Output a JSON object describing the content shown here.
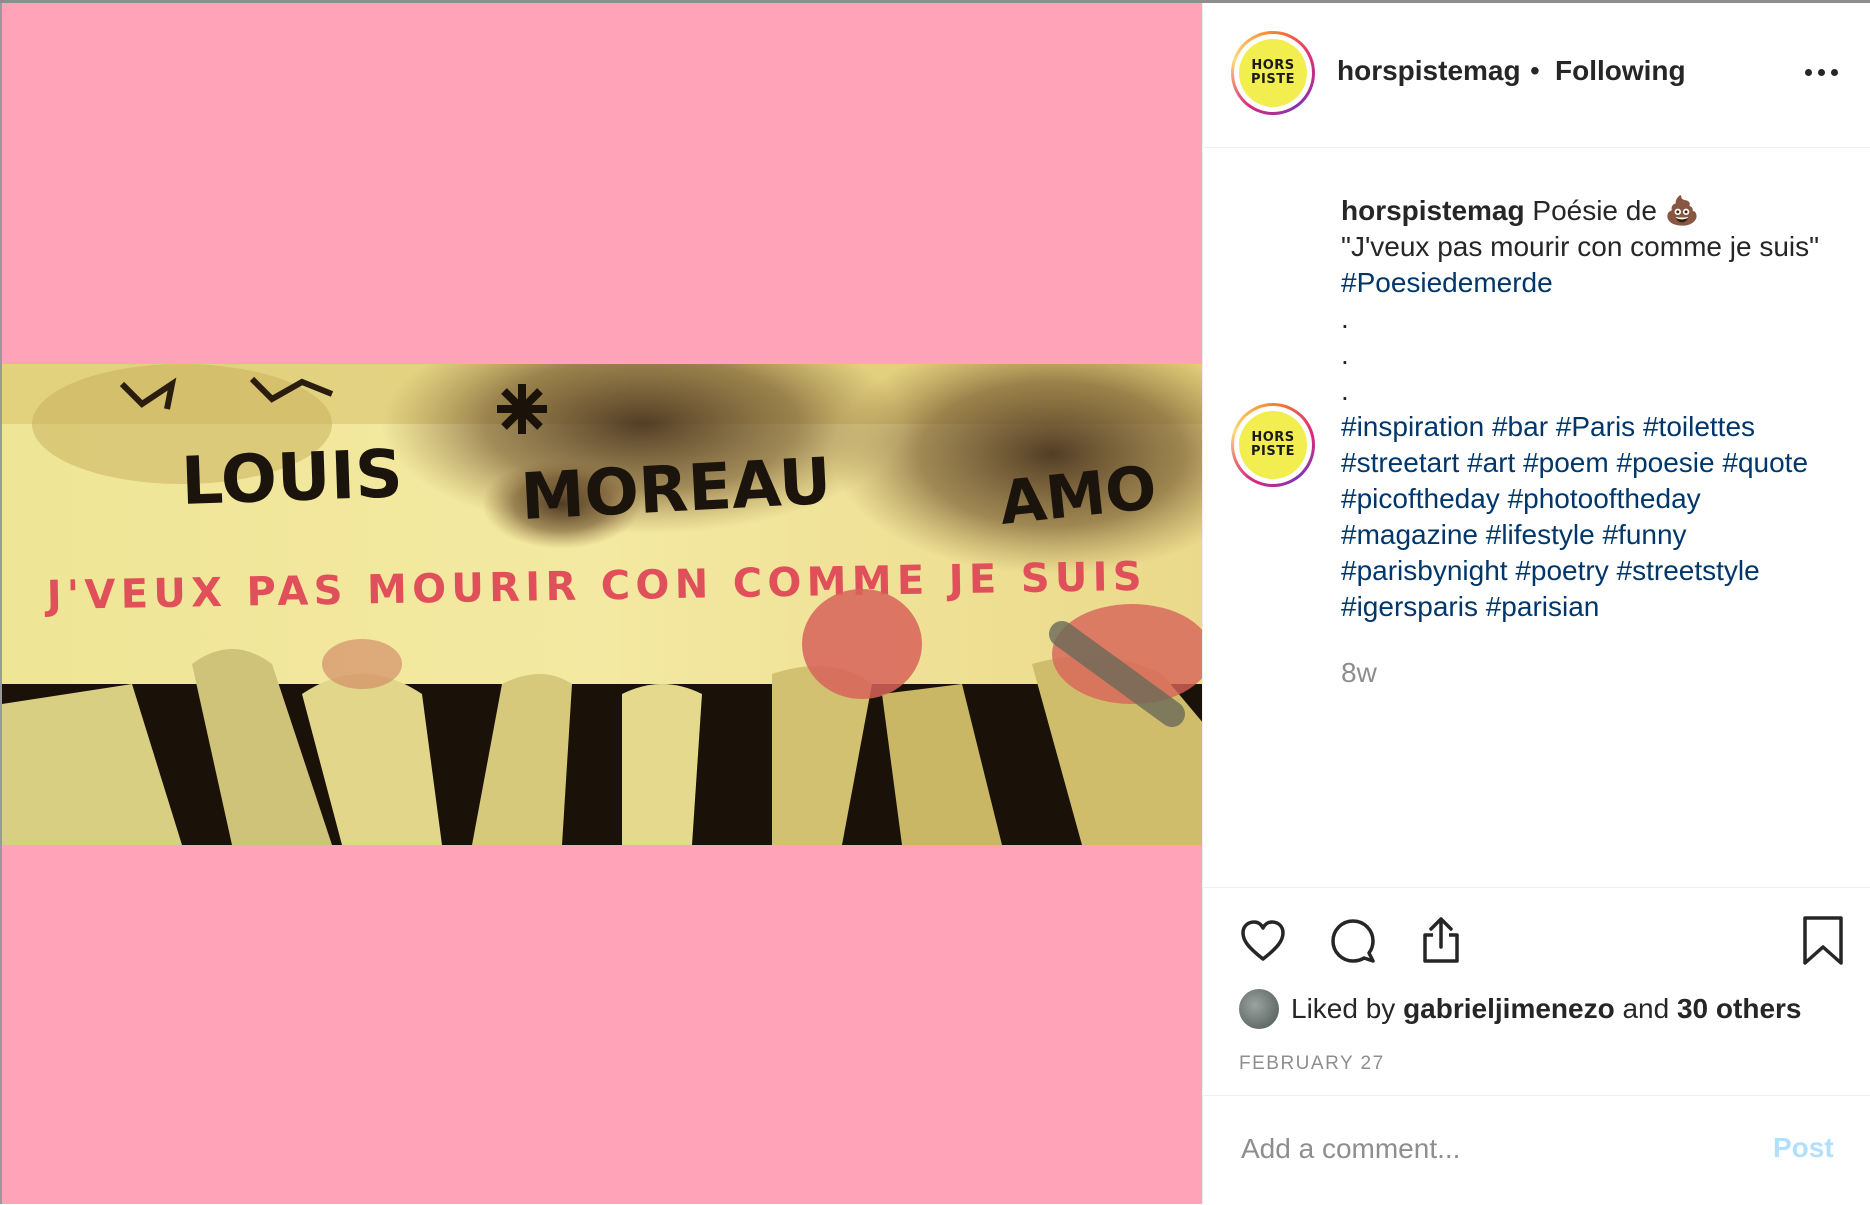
{
  "post": {
    "username": "horspistemag",
    "separator": "•",
    "follow_status": "Following",
    "avatar_text_line1": "HORS",
    "avatar_text_line2": "PISTE",
    "photo_text": {
      "line1_a": "LOUIS",
      "line1_b": "MOREAU",
      "line1_c": "AMO",
      "red_line": "J'VEUX PAS MOURIR CON COMME JE SUIS"
    }
  },
  "caption": {
    "username": "horspistemag",
    "text": "Poésie de 💩",
    "quote": "\"J'veux pas mourir con comme je suis\"",
    "hashtag": "#Poesiedemerde",
    "dot1": ".",
    "dot2": ".",
    "dot3": "."
  },
  "tags": [
    "#inspiration",
    "#bar",
    "#Paris",
    "#toilettes",
    "#streetart",
    "#art",
    "#poem",
    "#poesie",
    "#quote",
    "#picoftheday",
    "#photooftheday",
    "#magazine",
    "#lifestyle",
    "#funny",
    "#parisbynight",
    "#poetry",
    "#streetstyle",
    "#igersparis",
    "#parisian"
  ],
  "meta": {
    "age": "8w",
    "date": "FEBRUARY 27"
  },
  "likes": {
    "prefix": "Liked by",
    "user": "gabrieljimenezo",
    "and": "and",
    "others": "30 others"
  },
  "comment": {
    "placeholder": "Add a comment...",
    "post_label": "Post"
  },
  "colors": {
    "media_bg": "#ffa3b9",
    "link": "#00376b",
    "post_disabled": "#b2dffc",
    "avatar_yellow": "#f2ee4f"
  },
  "icons": [
    "heart-icon",
    "comment-icon",
    "share-icon",
    "bookmark-icon",
    "more-icon"
  ]
}
